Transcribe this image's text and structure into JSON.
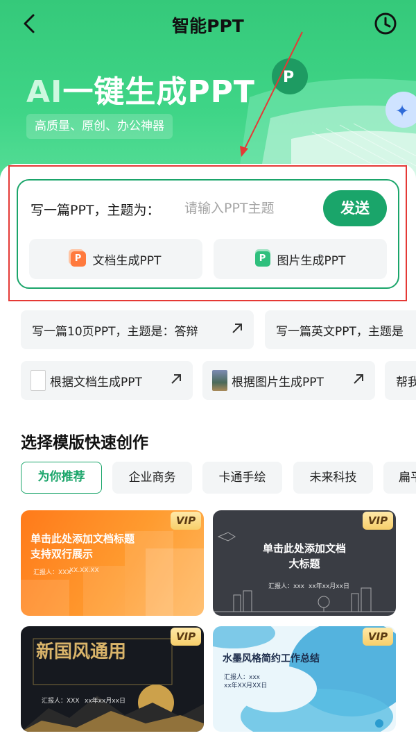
{
  "header": {
    "title": "智能PPT"
  },
  "hero": {
    "title_ai": "AI",
    "title_rest": "一键生成PPT",
    "subtitle": "高质量、原创、办公神器"
  },
  "prompt": {
    "label": "写一篇PPT，主题为：",
    "placeholder": "请输入PPT主题",
    "send_label": "发送"
  },
  "generate": {
    "doc_label": "文档生成PPT",
    "img_label": "图片生成PPT",
    "icon_text": "P"
  },
  "suggestions": {
    "row1": [
      {
        "label": "写一篇10页PPT，主题是：答辩"
      },
      {
        "label": "写一篇英文PPT，主题是"
      }
    ],
    "row2": [
      {
        "label": "根据文档生成PPT"
      },
      {
        "label": "根据图片生成PPT"
      },
      {
        "label": "帮我"
      }
    ]
  },
  "templates_section": {
    "title": "选择模版快速创作",
    "tabs": [
      "为你推荐",
      "企业商务",
      "卡通手绘",
      "未来科技",
      "扁平"
    ],
    "active_tab": "为你推荐"
  },
  "templates": [
    {
      "badge": "VIP",
      "title_line1": "单击此处添加文档标题",
      "title_line2": "支持双行展示",
      "meta_left": "汇报人：XXX",
      "meta_right": "XX.XX.XX"
    },
    {
      "badge": "VIP",
      "title_line1": "单击此处添加文档",
      "title_line2": "大标题",
      "meta_left": "汇报人：xxx",
      "meta_right": "xx年xx月xx日"
    },
    {
      "badge": "VIP",
      "title_line1": "新国风通用",
      "meta_left": "汇报人：XXX",
      "meta_right": "xx年xx月xx日"
    },
    {
      "badge": "VIP",
      "title_line1": "水墨风格简约工作总结",
      "meta_left": "汇报人：xxx",
      "meta_right": "xx年XX月XX日"
    }
  ],
  "colors": {
    "brand_green": "#1aa56a",
    "hero_green": "#3fd587",
    "annotation_red": "#e53935"
  }
}
